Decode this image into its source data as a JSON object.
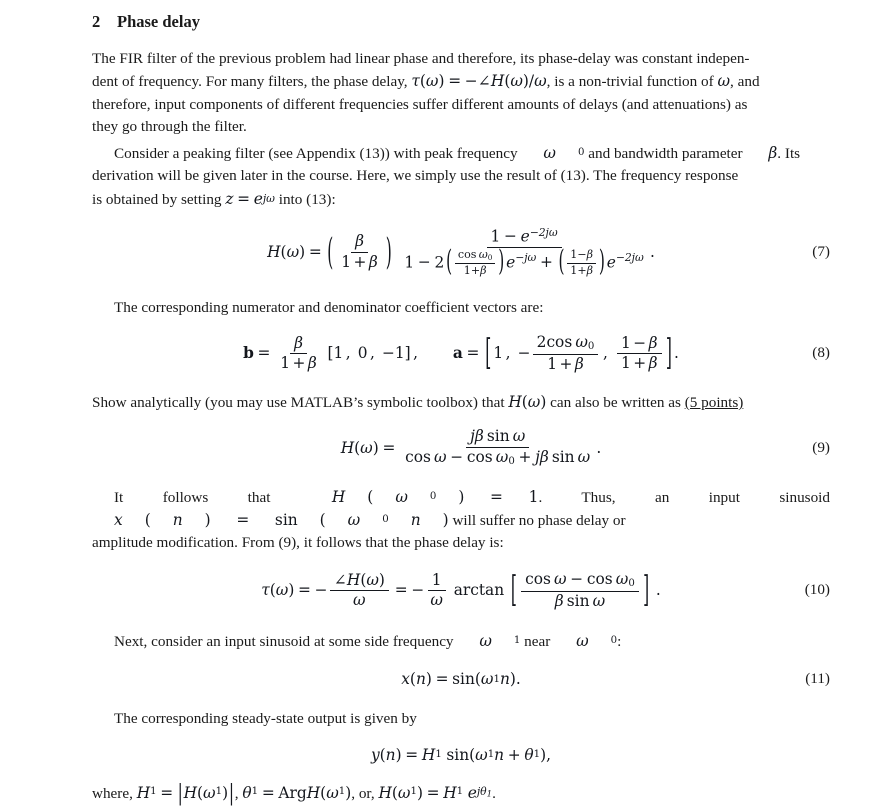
{
  "document": {
    "section": {
      "number": "2",
      "title": "Phase delay"
    },
    "paragraphs": {
      "p1_line1": "The FIR filter of the previous problem had linear phase and therefore, its phase-delay was constant indepen-",
      "p1_line2_a": "dent of frequency. For many filters, the phase delay, ",
      "p1_line2_b": ", is a non-trivial function of ",
      "p1_line2_c": ", and",
      "p1_line3": "therefore, input components of different frequencies suffer different amounts of delays (and attenuations) as",
      "p1_line4": "they go through the filter.",
      "p2_line1_a": "Consider a peaking filter (see Appendix (13)) with peak frequency ",
      "p2_line1_b": " and bandwidth parameter ",
      "p2_line1_c": ". Its",
      "p2_line2": "derivation will be given later in the course. Here, we simply use the result of (13). The frequency response",
      "p2_line3_a": "is obtained by setting ",
      "p2_line3_b": " into (13):",
      "p3": "The corresponding numerator and denominator coefficient vectors are:",
      "p4_a": "Show analytically (you may use MATLAB’s symbolic toolbox) that ",
      "p4_b": " can also be written as ",
      "p4_points": "(5 points)",
      "p5_line1_a": "It follows that ",
      "p5_line1_b": ". Thus, an input sinusoid ",
      "p5_line1_c": " will suffer no phase delay or",
      "p5_line2": "amplitude modification. From (9), it follows that the phase delay is:",
      "p6_a": "Next, consider an input sinusoid at some side frequency ",
      "p6_b": " near ",
      "p6_c": ":",
      "p7": "The corresponding steady-state output is given by",
      "p8_a": "where, ",
      "p8_b": ", ",
      "p8_c": ", or, ",
      "p8_d": "."
    },
    "inline_math": {
      "tau_def": "τ(ω) = −∠H(ω)/ω",
      "omega": "ω",
      "omega0": "ω₀",
      "beta": "β",
      "z_eq": "z = e^{jω}",
      "H_omega": "H(ω)",
      "H_omega0_eq1": "H(ω₀) = 1",
      "x_n_sin": "x(n) = sin(ω₀n)",
      "omega1": "ω₁",
      "H1_abs": "H₁ = |H(ω₁)|",
      "theta1_arg": "θ₁ = ArgH(ω₁)",
      "H_omega1_polar": "H(ω₁) = H₁ e^{jθ₁}"
    },
    "equations": [
      {
        "id": "eq7",
        "number": "(7)",
        "latex": "H(\\omega) = \\left(\\frac{\\beta}{1+\\beta}\\right)\\frac{1-e^{-2j\\omega}}{1-2\\left(\\frac{\\cos\\omega_0}{1+\\beta}\\right)e^{-j\\omega}+\\left(\\frac{1-\\beta}{1+\\beta}\\right)e^{-2j\\omega}}."
      },
      {
        "id": "eq8",
        "number": "(8)",
        "latex": "\\mathbf{b} = \\frac{\\beta}{1+\\beta}\\,[1,\\;0,\\;-1]\\,,\\qquad \\mathbf{a} = \\left[1,\\; -\\frac{2\\cos\\omega_0}{1+\\beta},\\; \\frac{1-\\beta}{1+\\beta}\\right]."
      },
      {
        "id": "eq9",
        "number": "(9)",
        "latex": "H(\\omega) = \\frac{j\\beta\\sin\\omega}{\\cos\\omega-\\cos\\omega_0+j\\beta\\sin\\omega}."
      },
      {
        "id": "eq10",
        "number": "(10)",
        "latex": "\\tau(\\omega) = -\\frac{\\angle H(\\omega)}{\\omega} = -\\frac{1}{\\omega}\\,\\arctan\\left[\\frac{\\cos\\omega-\\cos\\omega_0}{\\beta\\sin\\omega}\\right]."
      },
      {
        "id": "eq11",
        "number": "(11)",
        "latex": "x(n) = \\sin(\\omega_1 n)."
      },
      {
        "id": "eq_y",
        "number": "",
        "latex": "y(n) = H_1\\,\\sin(\\omega_1 n + \\theta_1),"
      }
    ],
    "symbols": {
      "H": "H",
      "tau": "τ",
      "beta": "β",
      "theta": "θ",
      "omega": "ω",
      "angle": "∠",
      "arctan": "arctan",
      "cos": "cos",
      "sin": "sin",
      "Arg": "Arg",
      "b_vec": "b",
      "a_vec": "a"
    }
  }
}
